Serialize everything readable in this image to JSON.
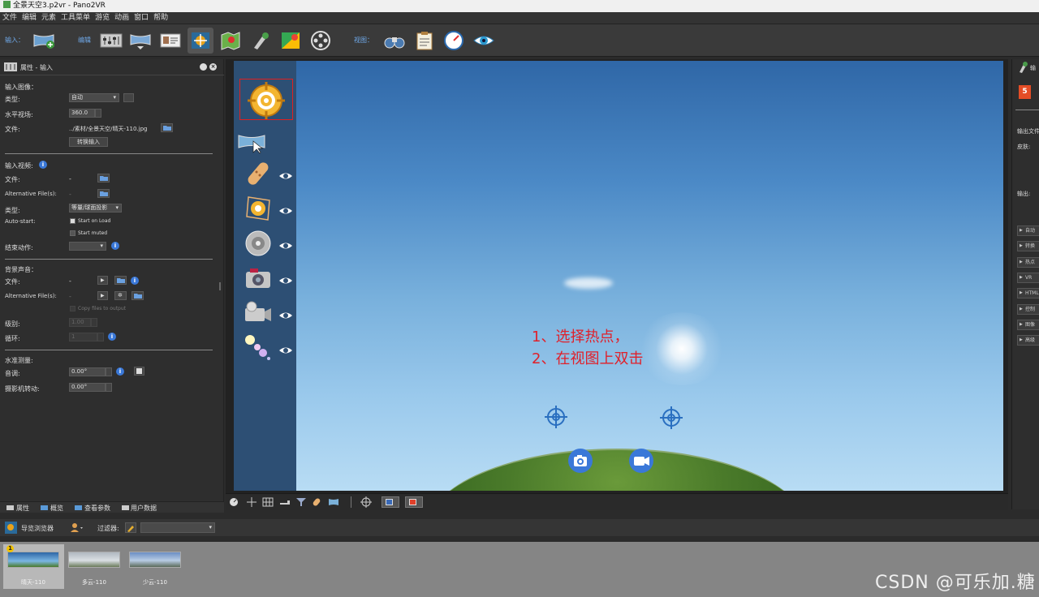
{
  "window": {
    "title": "全景天空3.p2vr - Pano2VR"
  },
  "menu": [
    "文件",
    "编辑",
    "元素",
    "工具菜单",
    "游览",
    "动画",
    "窗口",
    "帮助"
  ],
  "toolbar": {
    "input_label": "输入：",
    "edit_label": "编辑",
    "view_label": "视图："
  },
  "left_panel": {
    "title": "属性 - 输入",
    "input_image": {
      "section": "输入图像：",
      "type_label": "类型:",
      "type_value": "自动",
      "fov_label": "水平视场:",
      "fov_value": "360.0",
      "file_label": "文件:",
      "file_value": "../素材/全景天空/晴天-110.jpg",
      "convert_button": "转换输入"
    },
    "input_video": {
      "section": "输入视频:",
      "file_label": "文件:",
      "file_value": "-",
      "alt_label": "Alternative File(s):",
      "alt_value": "-",
      "type_label": "类型:",
      "type_value": "等量/球面投影",
      "autostart_label": "Auto-start:",
      "start_on_load": "Start on Load",
      "start_muted": "Start muted",
      "end_action_label": "结束动作:"
    },
    "bg_sound": {
      "section": "背景声音：",
      "file_label": "文件:",
      "file_value": "-",
      "alt_label": "Alternative File(s):",
      "alt_value": "-",
      "copy_files": "Copy files to output",
      "level_label": "级别:",
      "level_value": "1.00",
      "loop_label": "循环:",
      "loop_value": "1"
    },
    "leveling": {
      "section": "水准测量:",
      "pitch_label": "音调:",
      "pitch_value": "0.00°",
      "roll_label": "摄影机转动:",
      "roll_value": "0.00°"
    },
    "tabs": [
      "属性",
      "概览",
      "查看参数",
      "用户数据"
    ]
  },
  "viewport": {
    "annotation_line1": "1、选择热点，",
    "annotation_line2": "2、在视图上双击"
  },
  "right_panel": {
    "header_label": "输",
    "output_file_label": "输出文件",
    "skin_label": "皮肤:",
    "output_label": "输出:",
    "buttons": [
      "自动",
      "转换",
      "热点",
      "VR",
      "HTML",
      "控制",
      "图像",
      "高级"
    ]
  },
  "navigator": {
    "title": "导览浏览器",
    "filter_label": "过滤器:"
  },
  "thumbnails": [
    {
      "label": "晴天-110",
      "badge": "1"
    },
    {
      "label": "多云-110"
    },
    {
      "label": "少云-110"
    }
  ],
  "watermark": "CSDN @可乐加.糖",
  "colors": {
    "accent_blue": "#3a78d8",
    "annotation_red": "#e0202a",
    "hotspot_orange": "#e8a21a",
    "selection_red": "#e02020"
  }
}
